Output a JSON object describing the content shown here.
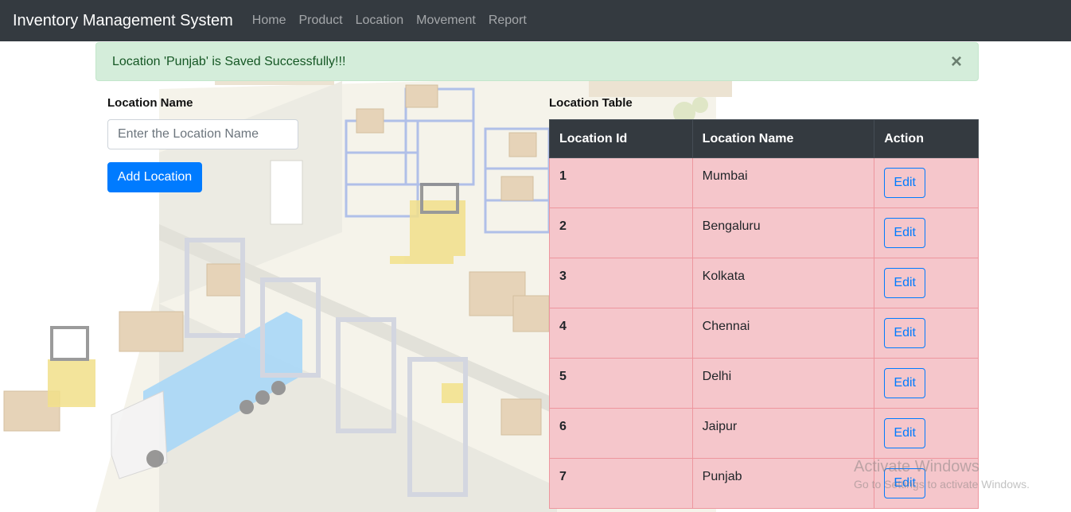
{
  "navbar": {
    "brand": "Inventory Management System",
    "links": [
      "Home",
      "Product",
      "Location",
      "Movement",
      "Report"
    ]
  },
  "alert": {
    "message": "Location 'Punjab' is Saved Successfully!!!",
    "close_symbol": "×"
  },
  "form": {
    "label": "Location Name",
    "placeholder": "Enter the Location Name",
    "value": "",
    "submit_label": "Add Location"
  },
  "table": {
    "title": "Location Table",
    "headers": [
      "Location Id",
      "Location Name",
      "Action"
    ],
    "rows": [
      {
        "id": "1",
        "name": "Mumbai",
        "action": "Edit"
      },
      {
        "id": "2",
        "name": "Bengaluru",
        "action": "Edit"
      },
      {
        "id": "3",
        "name": "Kolkata",
        "action": "Edit"
      },
      {
        "id": "4",
        "name": "Chennai",
        "action": "Edit"
      },
      {
        "id": "5",
        "name": "Delhi",
        "action": "Edit"
      },
      {
        "id": "6",
        "name": "Jaipur",
        "action": "Edit"
      },
      {
        "id": "7",
        "name": "Punjab",
        "action": "Edit"
      }
    ]
  },
  "watermark": {
    "title": "Activate Windows",
    "subtitle": "Go to Settings to activate Windows."
  },
  "colors": {
    "navbar_bg": "#343a40",
    "alert_bg": "#d4edda",
    "alert_text": "#155724",
    "primary": "#007bff",
    "row_bg": "#f5c6cb"
  }
}
